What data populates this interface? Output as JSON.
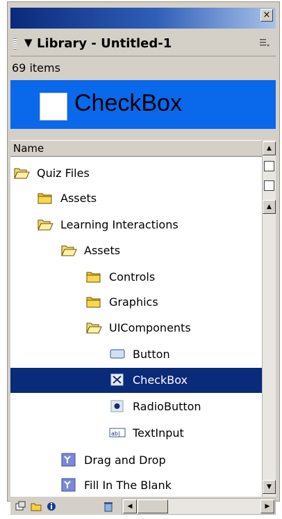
{
  "window": {
    "close_glyph": "×"
  },
  "header": {
    "collapse_glyph": "▼",
    "title": "Library - Untitled-1",
    "options_icon": "panel-options-icon"
  },
  "status": {
    "item_count": "69 items"
  },
  "preview": {
    "label": "CheckBox",
    "icon": "checkbox-preview-icon"
  },
  "list": {
    "column_header": "Name",
    "items": [
      {
        "label": "Quiz Files",
        "icon": "folder-open-icon",
        "depth": 0
      },
      {
        "label": "Assets",
        "icon": "folder-closed-icon",
        "depth": 1
      },
      {
        "label": "Learning Interactions",
        "icon": "folder-open-icon",
        "depth": 1
      },
      {
        "label": "Assets",
        "icon": "folder-open-icon",
        "depth": 2
      },
      {
        "label": "Controls",
        "icon": "folder-closed-icon",
        "depth": 3
      },
      {
        "label": "Graphics",
        "icon": "folder-closed-icon",
        "depth": 3
      },
      {
        "label": "UIComponents",
        "icon": "folder-open-icon",
        "depth": 3
      },
      {
        "label": "Button",
        "icon": "button-component-icon",
        "depth": 4
      },
      {
        "label": "CheckBox",
        "icon": "checkbox-component-icon",
        "depth": 4,
        "selected": true
      },
      {
        "label": "RadioButton",
        "icon": "radiobutton-component-icon",
        "depth": 4
      },
      {
        "label": "TextInput",
        "icon": "textinput-component-icon",
        "depth": 4
      },
      {
        "label": "Drag and Drop",
        "icon": "movieclip-symbol-icon",
        "depth": 2
      },
      {
        "label": "Fill In The Blank",
        "icon": "movieclip-symbol-icon",
        "depth": 2
      }
    ]
  },
  "footer": {
    "icons": [
      "new-symbol-icon",
      "new-folder-icon",
      "properties-icon",
      "delete-icon"
    ]
  },
  "colors": {
    "title_gradient_start": "#0a2a7a",
    "preview_bg": "#0a68ea",
    "selected_row_bg": "#0a2a7a",
    "panel_bg": "#d4d0c8"
  }
}
